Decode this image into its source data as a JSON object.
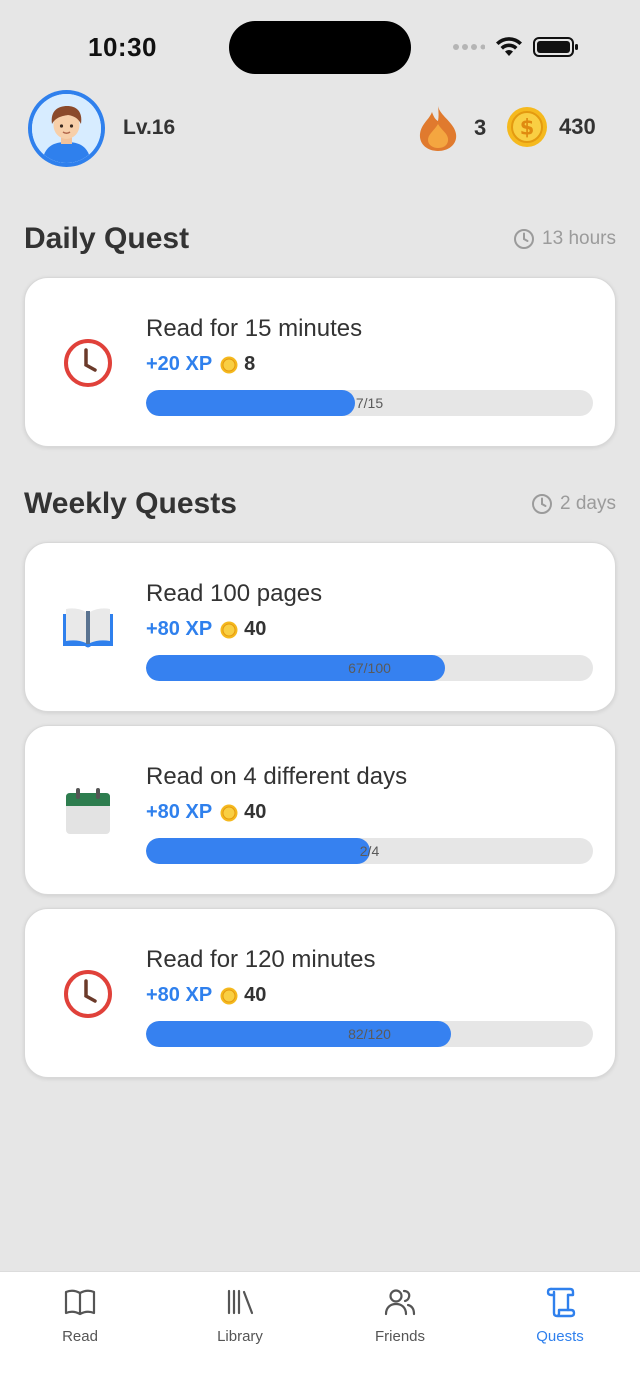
{
  "status_bar": {
    "time": "10:30"
  },
  "header": {
    "level": "Lv.16",
    "streak": "3",
    "coins": "430"
  },
  "daily": {
    "title": "Daily Quest",
    "timer": "13 hours",
    "quests": [
      {
        "title": "Read for 15 minutes",
        "xp": "+20 XP",
        "coins": "8",
        "progress_label": "7/15",
        "progress": 0.4667,
        "icon": "clock-icon"
      }
    ]
  },
  "weekly": {
    "title": "Weekly Quests",
    "timer": "2 days",
    "quests": [
      {
        "title": "Read 100 pages",
        "xp": "+80 XP",
        "coins": "40",
        "progress_label": "67/100",
        "progress": 0.67,
        "icon": "book-icon"
      },
      {
        "title": "Read on 4 different days",
        "xp": "+80 XP",
        "coins": "40",
        "progress_label": "2/4",
        "progress": 0.5,
        "icon": "calendar-icon"
      },
      {
        "title": "Read for 120 minutes",
        "xp": "+80 XP",
        "coins": "40",
        "progress_label": "82/120",
        "progress": 0.6833,
        "icon": "clock-icon"
      }
    ]
  },
  "tabs": [
    {
      "label": "Read",
      "icon": "open-book-icon"
    },
    {
      "label": "Library",
      "icon": "library-icon"
    },
    {
      "label": "Friends",
      "icon": "friends-icon"
    },
    {
      "label": "Quests",
      "icon": "scroll-icon",
      "active": true
    }
  ],
  "colors": {
    "accent": "#2f80ed",
    "progress_fill": "#3681f0",
    "background": "#e6e6e6"
  }
}
